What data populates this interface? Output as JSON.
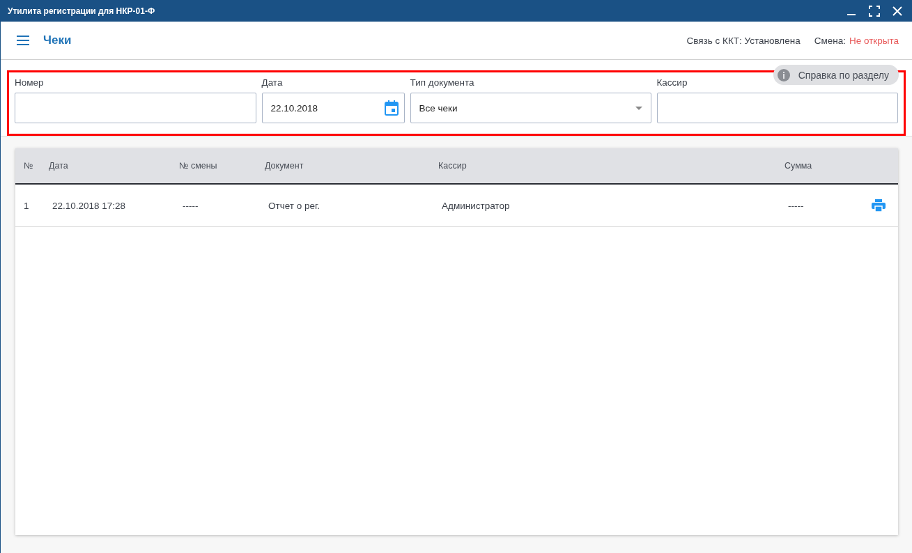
{
  "window": {
    "title": "Утилита регистрации для НКР-01-Ф"
  },
  "header": {
    "title": "Чеки",
    "connection_label": "Связь с ККТ:",
    "connection_value": "Установлена",
    "shift_label": "Смена:",
    "shift_value": "Не открыта"
  },
  "help_button": {
    "label": "Справка по разделу"
  },
  "filters": [
    {
      "kind": "text",
      "label": "Номер"
    },
    {
      "kind": "date",
      "label": "Дата",
      "value": "22.10.2018"
    },
    {
      "kind": "select",
      "label": "Тип документа",
      "value": "Все чеки"
    },
    {
      "kind": "text",
      "label": "Кассир"
    }
  ],
  "table": {
    "columns": [
      "№",
      "Дата",
      "№ смены",
      "Документ",
      "Кассир",
      "Сумма"
    ],
    "rows": [
      {
        "cells": [
          "1",
          "22.10.2018 17:28",
          "-----",
          "Отчет о рег.",
          "Администратор",
          "-----"
        ]
      }
    ]
  }
}
